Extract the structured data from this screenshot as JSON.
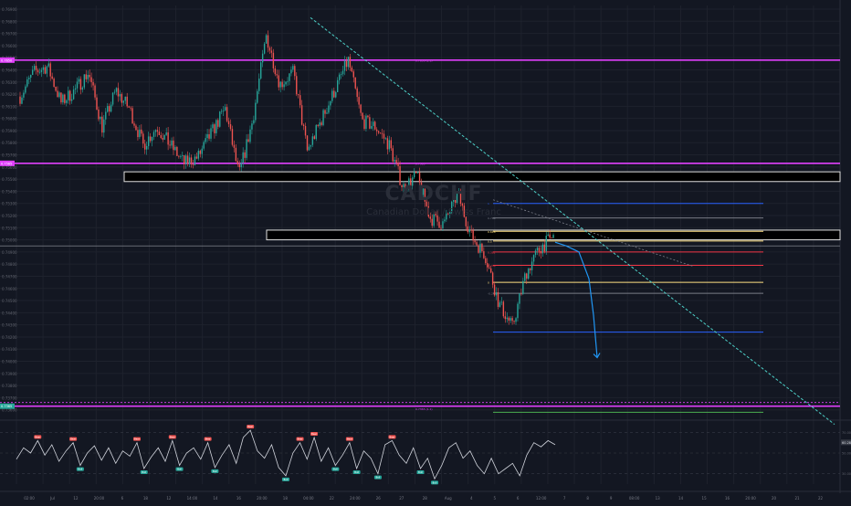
{
  "watermark": {
    "ticker": "CADCHF",
    "description": "Canadian Dollar / Swiss Franc"
  },
  "price_axis": {
    "ticks": [
      "0.76900",
      "0.76800",
      "0.76700",
      "0.76600",
      "0.76500",
      "0.76400",
      "0.76300",
      "0.76200",
      "0.76100",
      "0.76000",
      "0.75900",
      "0.75800",
      "0.75700",
      "0.75600",
      "0.75500",
      "0.75400",
      "0.75300",
      "0.75200",
      "0.75100",
      "0.75000",
      "0.74900",
      "0.74800",
      "0.74700",
      "0.74600",
      "0.74500",
      "0.74400",
      "0.74300",
      "0.74200",
      "0.74100",
      "0.74000",
      "0.73900",
      "0.73800",
      "0.73700",
      "0.73600"
    ],
    "badges": [
      {
        "label": "0.7650",
        "color": "#e040fb"
      },
      {
        "label": "0.7565",
        "color": "#e040fb"
      },
      {
        "label": "0.7365",
        "color": "#26a69a"
      }
    ]
  },
  "osc_axis": {
    "ticks": [
      "70.00",
      "50.00",
      "30.00"
    ],
    "badge": {
      "label": "60.28",
      "color": "#363a45"
    }
  },
  "time_axis": {
    "ticks": [
      "02:00",
      "Jul",
      "12",
      "20:00",
      "6",
      "18",
      "12",
      "14:00",
      "14",
      "16",
      "20:00",
      "18",
      "04:00",
      "22",
      "24:00",
      "26",
      "27",
      "28",
      "Aug",
      "4",
      "5",
      "6",
      "12:00",
      "7",
      "8",
      "9",
      "08:00",
      "13",
      "14",
      "15",
      "16",
      "20:00",
      "20",
      "21",
      "22"
    ]
  },
  "annotations": {
    "upper_level": "0.7650 (1.1)",
    "lower_level": "0.7365 (1.1)",
    "mid_level": "0.7565",
    "fib_labels": [
      "1",
      "0.786",
      "0.618",
      "0.5",
      "0.382",
      "0.236",
      "0",
      "-0.27"
    ]
  },
  "osc_labels": {
    "high": [
      "Bear",
      "Bear",
      "Bear",
      "Bear",
      "Bear",
      "Bear",
      "Bear",
      "Bear",
      "Bear",
      "Bear"
    ],
    "low": [
      "Bull",
      "Bull",
      "Bull",
      "Bull",
      "Bull",
      "Bull",
      "Bull",
      "Bull",
      "Bull",
      "Bull"
    ]
  },
  "colors": {
    "background": "#131722",
    "up": "#26a69a",
    "down": "#ef5350",
    "magenta": "#e040fb",
    "trend": "#4dd0c8",
    "projection": "#2196f3",
    "rsi": "#d1d4dc",
    "fib_blue": "#2962ff",
    "fib_yellow": "#ffe082",
    "fib_red": "#f23645"
  },
  "chart_data": {
    "type": "candlestick",
    "symbol": "CADCHF",
    "ylim": [
      0.7355,
      0.7695
    ],
    "levels": [
      0.765,
      0.7565,
      0.7365
    ],
    "zones": [
      {
        "from": 0.755,
        "to": 0.7558
      },
      {
        "from": 0.7502,
        "to": 0.751
      }
    ],
    "fib": [
      {
        "label": "1",
        "value": 0.7532,
        "color": "#2962ff"
      },
      {
        "label": "0.786",
        "value": 0.752,
        "color": "#787b86"
      },
      {
        "label": "0.618",
        "value": 0.7509,
        "color": "#ffe082"
      },
      {
        "label": "0.5",
        "value": 0.7501,
        "color": "#ffe082"
      },
      {
        "label": "0.382",
        "value": 0.7492,
        "color": "#f23645"
      },
      {
        "label": "0.236",
        "value": 0.7481,
        "color": "#f23645"
      },
      {
        "label": "0.1",
        "value": 0.7467,
        "color": "#ffe082"
      },
      {
        "label": "0",
        "value": 0.7458,
        "color": "#787b86"
      },
      {
        "label": "-0.27",
        "value": 0.7426,
        "color": "#2962ff"
      },
      {
        "label": "-0.618",
        "value": 0.736,
        "color": "#4caf50"
      }
    ],
    "trendline": {
      "from": [
        0,
        0.7685
      ],
      "to": [
        1,
        0.735
      ]
    },
    "projection": [
      0.75,
      0.7497,
      0.7492,
      0.747,
      0.744,
      0.7405
    ],
    "price_anchors": [
      0.762,
      0.764,
      0.7645,
      0.7615,
      0.7625,
      0.764,
      0.7595,
      0.7625,
      0.761,
      0.758,
      0.7595,
      0.758,
      0.7565,
      0.757,
      0.759,
      0.761,
      0.7555,
      0.76,
      0.767,
      0.763,
      0.764,
      0.7575,
      0.76,
      0.7625,
      0.765,
      0.76,
      0.7595,
      0.758,
      0.7545,
      0.7555,
      0.752,
      0.7515,
      0.754,
      0.7505,
      0.749,
      0.745,
      0.743,
      0.7475,
      0.7495,
      0.7505
    ],
    "rsi": [
      44,
      55,
      50,
      62,
      48,
      58,
      42,
      52,
      60,
      38,
      50,
      57,
      43,
      55,
      40,
      52,
      47,
      60,
      35,
      46,
      55,
      42,
      62,
      38,
      50,
      55,
      44,
      60,
      36,
      48,
      58,
      40,
      65,
      72,
      52,
      45,
      58,
      36,
      28,
      50,
      60,
      44,
      65,
      42,
      55,
      38,
      48,
      60,
      35,
      52,
      45,
      30,
      58,
      62,
      48,
      40,
      55,
      35,
      45,
      25,
      38,
      55,
      60,
      45,
      52,
      38,
      30,
      45,
      30,
      35,
      40,
      28,
      48,
      60,
      56,
      62,
      58
    ]
  }
}
